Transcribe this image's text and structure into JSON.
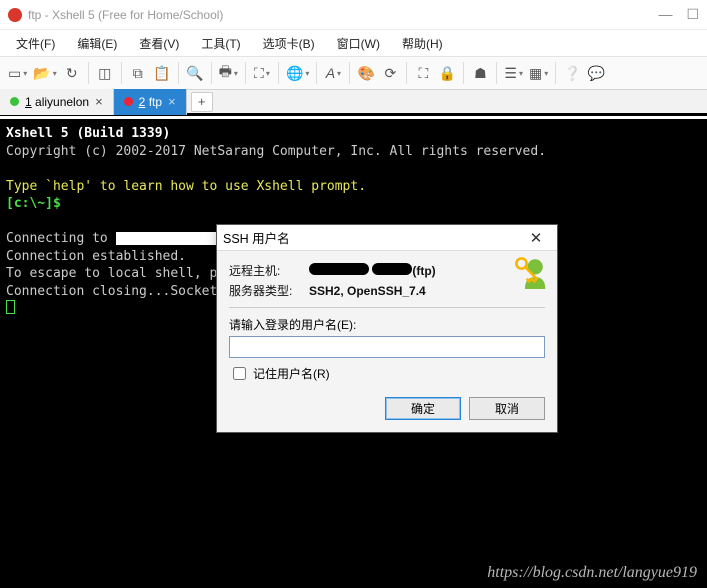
{
  "window": {
    "title": "ftp - Xshell 5 (Free for Home/School)"
  },
  "menu": {
    "file": "文件(F)",
    "edit": "编辑(E)",
    "view": "查看(V)",
    "tools": "工具(T)",
    "tabs": "选项卡(B)",
    "window": "窗口(W)",
    "help": "帮助(H)"
  },
  "tabs": {
    "0": {
      "index": "1",
      "label": "aliyunelon"
    },
    "1": {
      "index": "2",
      "label": "ftp"
    }
  },
  "terminal": {
    "l1": "Xshell 5 (Build 1339)",
    "l2": "Copyright (c) 2002-2017 NetSarang Computer, Inc. All rights reserved.",
    "l3": "Type `help' to learn how to use Xshell prompt.",
    "prompt": "[c:\\~]$",
    "l5a": "Connecting to ",
    "l5b": "...",
    "l6": "Connection established.",
    "l7": "To escape to local shell, pres",
    "l8": "Connection closing...Socket cl"
  },
  "dialog": {
    "title": "SSH 用户名",
    "remoteHostLabel": "远程主机:",
    "remoteHostSuffix": "(ftp)",
    "serverTypeLabel": "服务器类型:",
    "serverTypeValue": "SSH2, OpenSSH_7.4",
    "promptLabel": "请输入登录的用户名(E):",
    "username": "",
    "rememberLabel": "记住用户名(R)",
    "ok": "确定",
    "cancel": "取消"
  },
  "watermark": "https://blog.csdn.net/langyue919"
}
